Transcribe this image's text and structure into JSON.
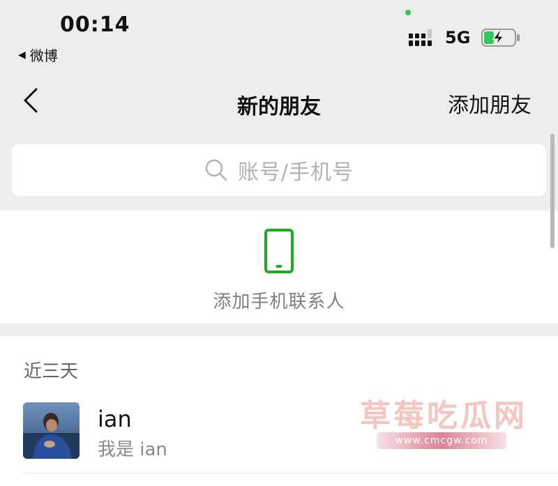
{
  "status_bar": {
    "time": "00:14",
    "back_app_arrow": "◀",
    "back_app": "微博",
    "network": "5G",
    "camera_dot_color": "#34c759",
    "battery_color": "#34c759"
  },
  "nav": {
    "back_icon": "chevron-left-icon",
    "title": "新的朋友",
    "add_friend": "添加朋友"
  },
  "search": {
    "icon": "search-icon",
    "placeholder": "账号/手机号"
  },
  "add_contacts": {
    "icon": "phone-icon",
    "label": "添加手机联系人",
    "accent_color": "#1aad19"
  },
  "recent": {
    "header": "近三天",
    "friends": [
      {
        "name": "ian",
        "message": "我是 ian"
      }
    ]
  },
  "watermark": {
    "title": "草莓吃瓜网",
    "url": "www.cmcgw.com"
  }
}
